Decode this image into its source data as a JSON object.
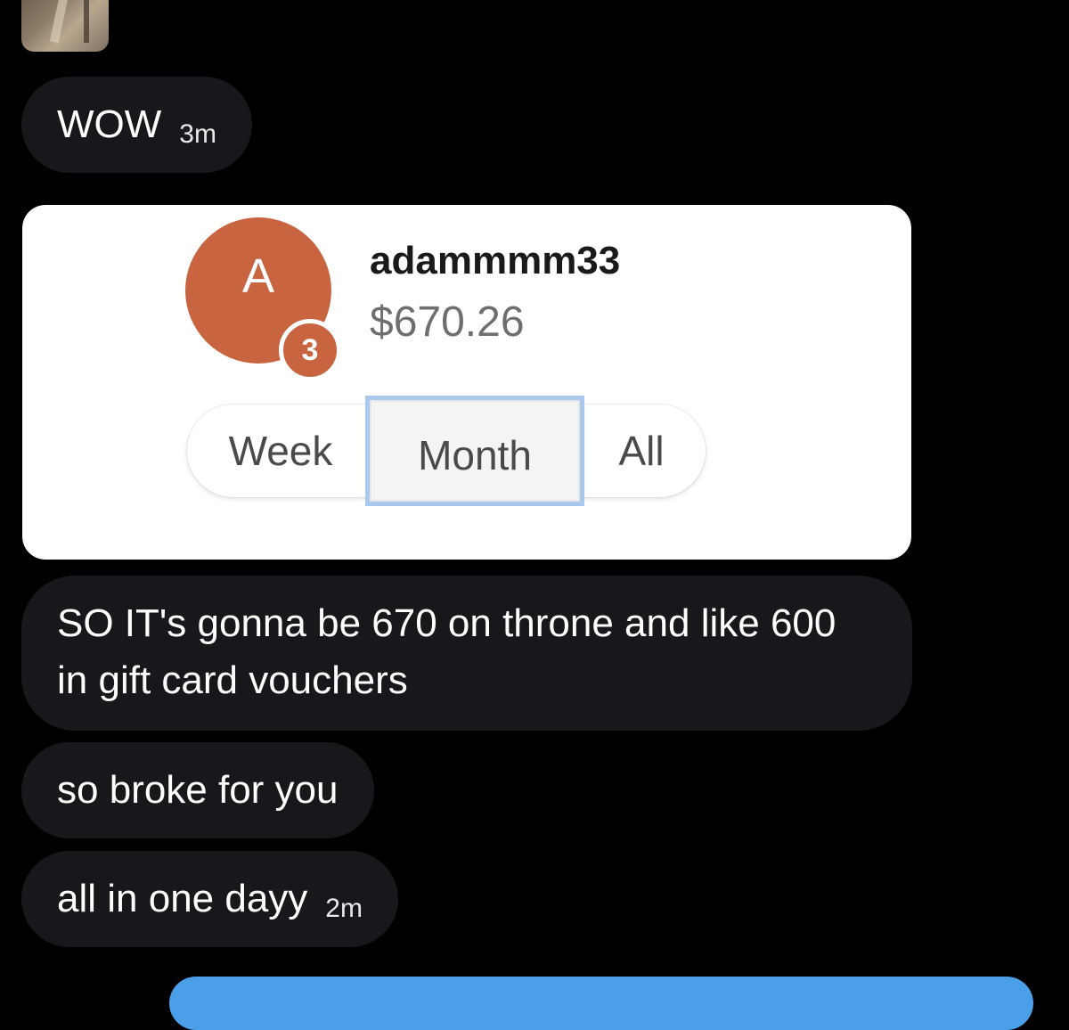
{
  "messages": [
    {
      "text": "WOW",
      "timestamp": "3m"
    },
    {
      "text": "SO IT's gonna be 670 on throne and like 600 in gift card vouchers"
    },
    {
      "text": "so broke for you"
    },
    {
      "text": "all in one dayy",
      "timestamp": "2m"
    }
  ],
  "card": {
    "avatar_letter": "A",
    "rank": "3",
    "username": "adammmm33",
    "amount": "$670.26",
    "tabs": [
      {
        "label": "Week"
      },
      {
        "label": "Month",
        "selected": true
      },
      {
        "label": "All"
      }
    ],
    "accent_color": "#c8643f",
    "selected_outline_color": "#a8c8ee"
  },
  "colors": {
    "background": "#000000",
    "bubble": "#16181c",
    "compose_accent": "#4a9fe8"
  }
}
